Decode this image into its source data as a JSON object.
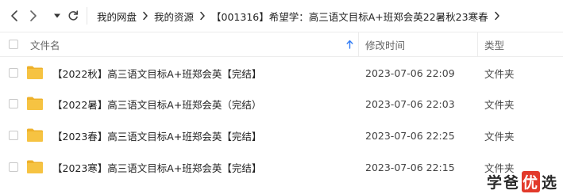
{
  "breadcrumb": {
    "items": [
      "我的网盘",
      "我的资源",
      "【001316】希望学：高三语文目标A+班郑会英22暑秋23寒春"
    ]
  },
  "header": {
    "name_label": "文件名",
    "time_label": "修改时间",
    "type_label": "类型"
  },
  "files": [
    {
      "name": "【2022秋】高三语文目标A+班郑会英【完结】",
      "modified": "2023-07-06 22:09",
      "type": "文件夹"
    },
    {
      "name": "【2022暑】高三语文目标A+班郑会英（完结）",
      "modified": "2023-07-06 22:03",
      "type": "文件夹"
    },
    {
      "name": "【2023春】高三语文目标A+班郑会英【完结】",
      "modified": "2023-07-06 22:25",
      "type": "文件夹"
    },
    {
      "name": "【2023寒】高三语文目标A+班郑会英【完结】",
      "modified": "2023-07-06 22:15",
      "type": "文件夹"
    }
  ],
  "watermark": {
    "char1": "学",
    "char2": "爸",
    "char3": "优",
    "char4": "选"
  },
  "colors": {
    "folder": "#f6c342",
    "folder_dark": "#eeb12a",
    "sort_arrow": "#2f7bf5",
    "watermark_accent": "#e23a2b"
  }
}
